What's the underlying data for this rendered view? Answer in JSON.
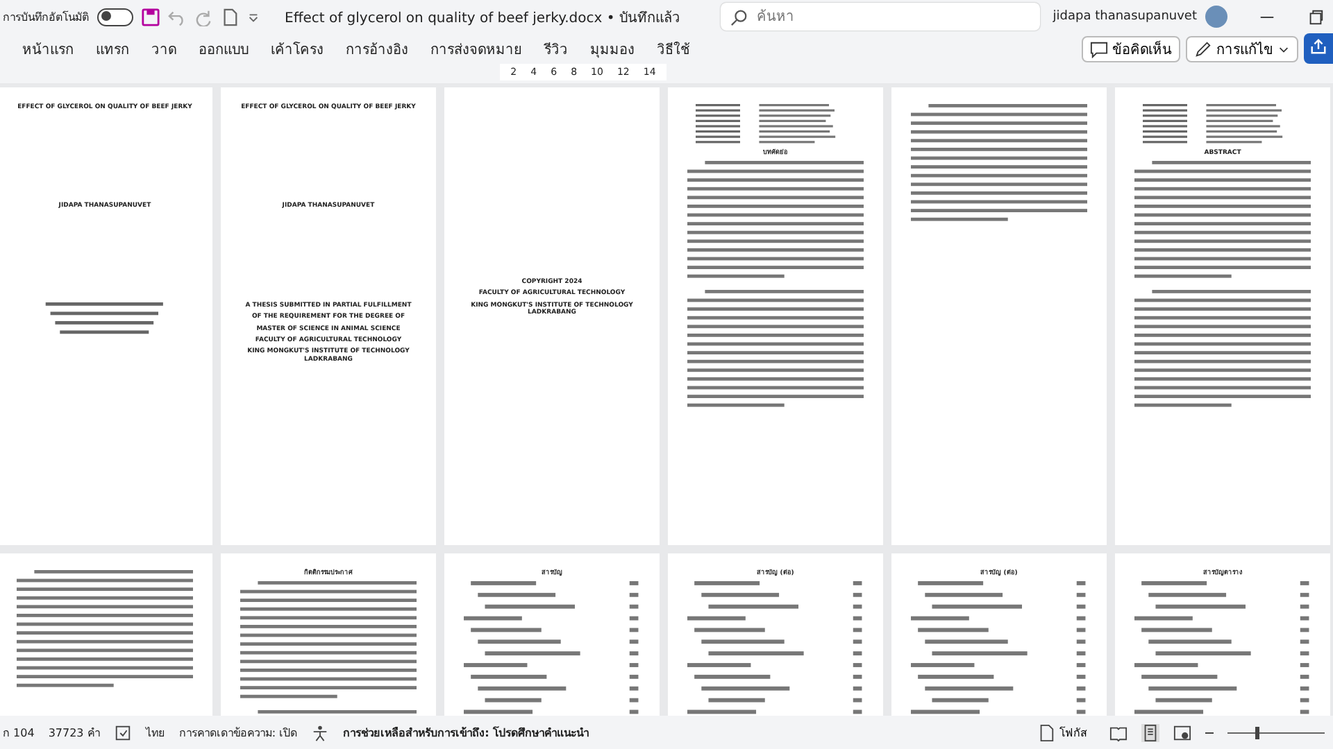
{
  "title_bar": {
    "autosave_label": "การบันทึกอัตโนมัติ",
    "autosave_on": false,
    "document_title": "Effect of glycerol on quality of beef jerky.docx • บันทึกแล้ว",
    "search": {
      "placeholder": "ค้นหา"
    },
    "user_name": "jidapa thanasupanuvet"
  },
  "ribbon_tabs": [
    {
      "label": "หน้าแรก",
      "selected": false
    },
    {
      "label": "แทรก",
      "selected": false
    },
    {
      "label": "วาด",
      "selected": false
    },
    {
      "label": "ออกแบบ",
      "selected": false
    },
    {
      "label": "เค้าโครง",
      "selected": false
    },
    {
      "label": "การอ้างอิง",
      "selected": false
    },
    {
      "label": "การส่งจดหมาย",
      "selected": false
    },
    {
      "label": "รีวิว",
      "selected": false
    },
    {
      "label": "มุมมอง",
      "selected": false
    },
    {
      "label": "วิธีใช้",
      "selected": false
    }
  ],
  "ribbon_buttons": {
    "comments": "ข้อคิดเห็น",
    "editing": "การแก้ไข"
  },
  "ruler": [
    "2",
    "4",
    "6",
    "8",
    "10",
    "12",
    "14"
  ],
  "pages": [
    {
      "blocks": [
        {
          "kind": "heading",
          "text": "EFFECT OF GLYCEROL ON QUALITY OF BEEF JERKY"
        },
        {
          "kind": "spacer"
        },
        {
          "kind": "heading",
          "text": "JIDAPA THANASUPANUVET"
        },
        {
          "kind": "spacer"
        },
        {
          "kind": "centered"
        }
      ]
    },
    {
      "blocks": [
        {
          "kind": "heading",
          "text": "EFFECT OF GLYCEROL ON QUALITY OF BEEF JERKY"
        },
        {
          "kind": "spacer"
        },
        {
          "kind": "heading",
          "text": "JIDAPA THANASUPANUVET"
        },
        {
          "kind": "spacer"
        },
        {
          "kind": "heading",
          "text": "A THESIS SUBMITTED IN PARTIAL FULFILLMENT"
        },
        {
          "kind": "heading",
          "text": "OF THE REQUIREMENT FOR THE DEGREE OF"
        },
        {
          "kind": "heading",
          "text": "MASTER OF SCIENCE IN ANIMAL SCIENCE"
        },
        {
          "kind": "heading",
          "text": "FACULTY OF AGRICULTURAL TECHNOLOGY"
        },
        {
          "kind": "heading",
          "text": "KING MONGKUT'S INSTITUTE OF TECHNOLOGY LADKRABANG"
        }
      ]
    },
    {
      "blocks": [
        {
          "kind": "spacer"
        },
        {
          "kind": "spacer"
        },
        {
          "kind": "heading",
          "text": "COPYRIGHT 2024"
        },
        {
          "kind": "heading",
          "text": "FACULTY OF AGRICULTURAL TECHNOLOGY"
        },
        {
          "kind": "heading",
          "text": "KING MONGKUT'S INSTITUTE OF TECHNOLOGY LADKRABANG"
        }
      ]
    },
    {
      "blocks": [
        {
          "kind": "fields"
        },
        {
          "kind": "heading",
          "text": "บทคัดย่อ"
        },
        {
          "kind": "paragraph"
        },
        {
          "kind": "paragraph"
        }
      ]
    },
    {
      "blocks": [
        {
          "kind": "paragraph"
        }
      ]
    },
    {
      "blocks": [
        {
          "kind": "fields"
        },
        {
          "kind": "heading",
          "text": "ABSTRACT"
        },
        {
          "kind": "paragraph"
        },
        {
          "kind": "paragraph"
        }
      ]
    },
    {
      "blocks": [
        {
          "kind": "paragraph"
        }
      ]
    },
    {
      "blocks": [
        {
          "kind": "heading",
          "text": "กิตติกรรมประกาศ"
        },
        {
          "kind": "paragraph"
        },
        {
          "kind": "paragraph"
        }
      ]
    },
    {
      "blocks": [
        {
          "kind": "heading",
          "text": "สารบัญ"
        },
        {
          "kind": "toc"
        }
      ]
    },
    {
      "blocks": [
        {
          "kind": "heading",
          "text": "สารบัญ (ต่อ)"
        },
        {
          "kind": "toc"
        }
      ]
    },
    {
      "blocks": [
        {
          "kind": "heading",
          "text": "สารบัญ (ต่อ)"
        },
        {
          "kind": "toc"
        }
      ]
    },
    {
      "blocks": [
        {
          "kind": "heading",
          "text": "สารบัญตาราง"
        },
        {
          "kind": "toc"
        }
      ]
    }
  ],
  "status_bar": {
    "page": "ก 104",
    "words": "37723 คำ",
    "language": "ไทย",
    "predictions": "การคาดเดาข้อความ: เปิด",
    "accessibility": "การช่วยเหลือสำหรับการเข้าถึง: โปรดศึกษาคำแนะนำ",
    "focus": "โฟกัส",
    "zoom": {
      "level": 0.3
    }
  }
}
